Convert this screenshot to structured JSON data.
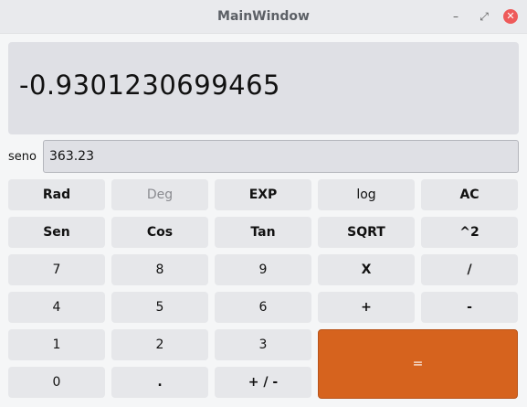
{
  "window": {
    "title": "MainWindow",
    "minimize_icon": "–",
    "maximize_icon": "⤢",
    "close_icon": "✕"
  },
  "display": {
    "value": "-0.9301230699465"
  },
  "input": {
    "label": "seno",
    "value": "363.23"
  },
  "buttons": {
    "rad": "Rad",
    "deg": "Deg",
    "exp": "EXP",
    "log": "log",
    "ac": "AC",
    "sen": "Sen",
    "cos": "Cos",
    "tan": "Tan",
    "sqrt": "SQRT",
    "pow2": "^2",
    "seven": "7",
    "eight": "8",
    "nine": "9",
    "times": "X",
    "divide": "/",
    "four": "4",
    "five": "5",
    "six": "6",
    "plus": "+",
    "minus": "-",
    "one": "1",
    "two": "2",
    "three": "3",
    "equals": "=",
    "zero": "0",
    "dot": ".",
    "sign": "+ / -"
  },
  "colors": {
    "equals_bg": "#d6631e",
    "close_bg": "#ee5a5a"
  }
}
